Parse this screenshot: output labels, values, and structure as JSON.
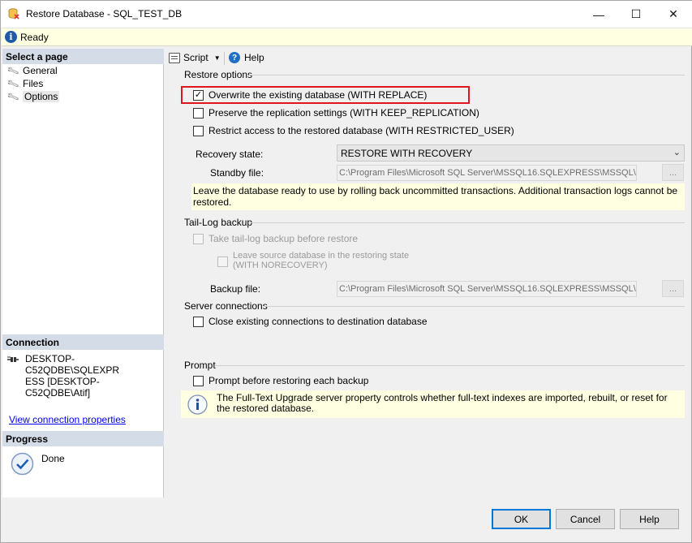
{
  "window": {
    "title": "Restore Database - SQL_TEST_DB",
    "minimize_label": "—",
    "maximize_label": "☐",
    "close_label": "✕"
  },
  "status": {
    "text": "Ready",
    "icon": "info-icon"
  },
  "left_pane": {
    "select_page_header": "Select a page",
    "pages": [
      {
        "label": "General",
        "icon": "wrench-icon",
        "selected": false
      },
      {
        "label": "Files",
        "icon": "wrench-icon",
        "selected": false
      },
      {
        "label": "Options",
        "icon": "wrench-icon",
        "selected": true
      }
    ],
    "connection_header": "Connection",
    "connection_line1": "DESKTOP-C52QDBE\\SQLEXPR",
    "connection_line2": "ESS [DESKTOP-C52QDBE\\Atif]",
    "view_connection_link": "View connection properties",
    "progress_header": "Progress",
    "progress_status": "Done"
  },
  "toolbar": {
    "script_label": "Script",
    "help_label": "Help"
  },
  "restore_options": {
    "group_label": "Restore options",
    "overwrite": {
      "label": "Overwrite the existing database (WITH REPLACE)",
      "checked": true
    },
    "preserve_replication": {
      "label": "Preserve the replication settings (WITH KEEP_REPLICATION)",
      "checked": false
    },
    "restrict_access": {
      "label": "Restrict access to the restored database (WITH RESTRICTED_USER)",
      "checked": false
    },
    "recovery_state_label": "Recovery state:",
    "recovery_state_value": "RESTORE WITH RECOVERY",
    "standby_file_label": "Standby file:",
    "standby_file_value": "C:\\Program Files\\Microsoft SQL Server\\MSSQL16.SQLEXPRESS\\MSSQL\\B",
    "browse_label": "...",
    "recovery_description": "Leave the database ready to use by rolling back uncommitted transactions. Additional transaction logs cannot be restored."
  },
  "tail_log": {
    "group_label": "Tail-Log backup",
    "take_backup_label": "Take tail-log backup before restore",
    "leave_source_line1": "Leave source database in the restoring state",
    "leave_source_line2": "(WITH NORECOVERY)",
    "backup_file_label": "Backup file:",
    "backup_file_value": "C:\\Program Files\\Microsoft SQL Server\\MSSQL16.SQLEXPRESS\\MSSQL\\B",
    "browse_label": "..."
  },
  "server_connections": {
    "group_label": "Server connections",
    "close_existing_label": "Close existing connections to destination database"
  },
  "prompt": {
    "group_label": "Prompt",
    "prompt_before_label": "Prompt before restoring each backup",
    "info_text": "The Full-Text Upgrade server property controls whether full-text indexes are imported, rebuilt, or reset for the restored database."
  },
  "buttons": {
    "ok": "OK",
    "cancel": "Cancel",
    "help": "Help"
  },
  "colors": {
    "highlight": "#e0161e",
    "info_background": "#ffffe1",
    "pane_header": "#d4dce8",
    "default_button_border": "#0078d7"
  }
}
